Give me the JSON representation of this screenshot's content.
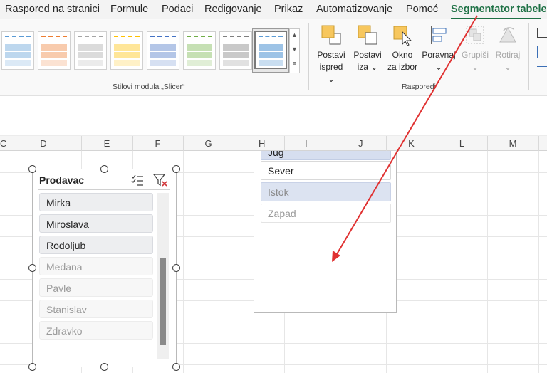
{
  "tabs": [
    {
      "label": "Raspored na stranici",
      "active": false
    },
    {
      "label": "Formule",
      "active": false
    },
    {
      "label": "Podaci",
      "active": false
    },
    {
      "label": "Redigovanje",
      "active": false
    },
    {
      "label": "Prikaz",
      "active": false
    },
    {
      "label": "Automatizovanje",
      "active": false
    },
    {
      "label": "Pomoć",
      "active": false
    },
    {
      "label": "Segmentator tabele",
      "active": true
    }
  ],
  "ribbon": {
    "styles_group_label": "Stilovi modula „Slicer“",
    "arrange_group_label": "Rasporedi",
    "buttons": {
      "bring_forward": {
        "line1": "Postavi",
        "line2": "ispred ⌄"
      },
      "send_backward": {
        "line1": "Postavi",
        "line2": "iza ⌄"
      },
      "selection_pane": {
        "line1": "Okno",
        "line2": "za izbor"
      },
      "align": {
        "line1": "Poravnaj",
        "line2": "⌄"
      },
      "group": {
        "line1": "Grupiši",
        "line2": "⌄"
      },
      "rotate": {
        "line1": "Rotiraj",
        "line2": "⌄"
      }
    },
    "style_swatch_colors": [
      "#5b9bd5",
      "#ed7d31",
      "#a5a5a5",
      "#ffc000",
      "#4472c4",
      "#70ad47",
      "#7f7f7f",
      "#5b9bd5"
    ]
  },
  "columns": [
    "C",
    "D",
    "E",
    "F",
    "G",
    "H",
    "I",
    "J",
    "K",
    "L",
    "M"
  ],
  "slicer_prodavac": {
    "title": "Prodavac",
    "items": [
      {
        "label": "Mirka",
        "state": "selected"
      },
      {
        "label": "Miroslava",
        "state": "selected"
      },
      {
        "label": "Rodoljub",
        "state": "selected"
      },
      {
        "label": "Medana",
        "state": "unselected"
      },
      {
        "label": "Pavle",
        "state": "unselected"
      },
      {
        "label": "Stanislav",
        "state": "unselected"
      },
      {
        "label": "Zdravko",
        "state": "unselected"
      }
    ]
  },
  "slicer_region": {
    "items": [
      {
        "label": "Jug",
        "state": "selected-blue"
      },
      {
        "label": "Sever",
        "state": "selected"
      },
      {
        "label": "Istok",
        "state": "nodata-blue"
      },
      {
        "label": "Zapad",
        "state": "nodata"
      }
    ]
  },
  "annotation_color": "#e03131"
}
